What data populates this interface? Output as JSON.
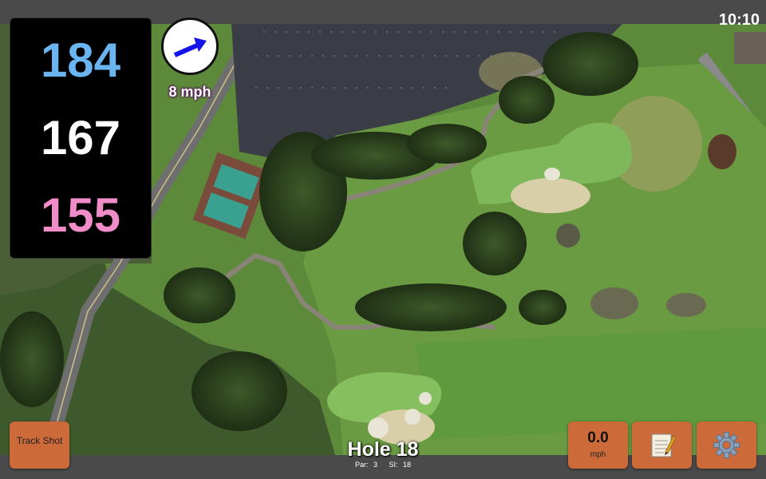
{
  "status": {
    "time": "10:10"
  },
  "distances": {
    "back": "184",
    "middle": "167",
    "front": "155"
  },
  "wind": {
    "speed_label": "8 mph",
    "arrow_icon": "wind-direction-arrow-icon"
  },
  "buttons": {
    "track_shot": "Track Shot",
    "speed_value": "0.0",
    "speed_unit": "mph",
    "notes_icon": "notepad-icon",
    "settings_icon": "gear-icon"
  },
  "hole": {
    "title": "Hole 18",
    "par": "Par: 3",
    "si": "SI: 18"
  },
  "colors": {
    "back": "#6ab4f0",
    "middle": "#ffffff",
    "front": "#f08cc8",
    "button": "#cc6a3a"
  }
}
